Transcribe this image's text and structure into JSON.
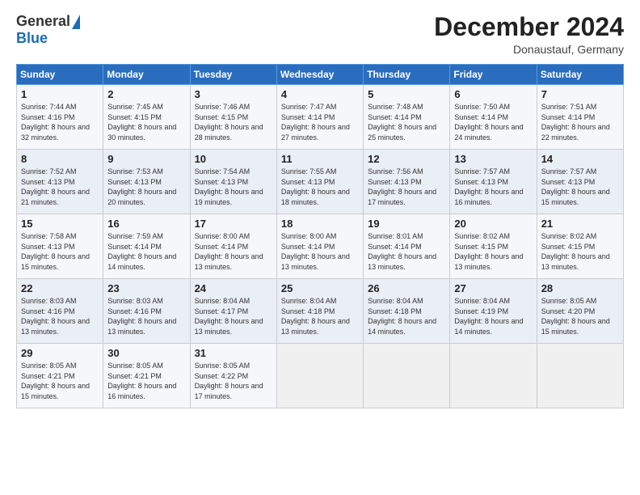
{
  "logo": {
    "general": "General",
    "blue": "Blue"
  },
  "header": {
    "month": "December 2024",
    "location": "Donaustauf, Germany"
  },
  "days_of_week": [
    "Sunday",
    "Monday",
    "Tuesday",
    "Wednesday",
    "Thursday",
    "Friday",
    "Saturday"
  ],
  "weeks": [
    [
      {
        "day": "1",
        "sunrise": "7:44 AM",
        "sunset": "4:16 PM",
        "daylight": "8 hours and 32 minutes."
      },
      {
        "day": "2",
        "sunrise": "7:45 AM",
        "sunset": "4:15 PM",
        "daylight": "8 hours and 30 minutes."
      },
      {
        "day": "3",
        "sunrise": "7:46 AM",
        "sunset": "4:15 PM",
        "daylight": "8 hours and 28 minutes."
      },
      {
        "day": "4",
        "sunrise": "7:47 AM",
        "sunset": "4:14 PM",
        "daylight": "8 hours and 27 minutes."
      },
      {
        "day": "5",
        "sunrise": "7:48 AM",
        "sunset": "4:14 PM",
        "daylight": "8 hours and 25 minutes."
      },
      {
        "day": "6",
        "sunrise": "7:50 AM",
        "sunset": "4:14 PM",
        "daylight": "8 hours and 24 minutes."
      },
      {
        "day": "7",
        "sunrise": "7:51 AM",
        "sunset": "4:14 PM",
        "daylight": "8 hours and 22 minutes."
      }
    ],
    [
      {
        "day": "8",
        "sunrise": "7:52 AM",
        "sunset": "4:13 PM",
        "daylight": "8 hours and 21 minutes."
      },
      {
        "day": "9",
        "sunrise": "7:53 AM",
        "sunset": "4:13 PM",
        "daylight": "8 hours and 20 minutes."
      },
      {
        "day": "10",
        "sunrise": "7:54 AM",
        "sunset": "4:13 PM",
        "daylight": "8 hours and 19 minutes."
      },
      {
        "day": "11",
        "sunrise": "7:55 AM",
        "sunset": "4:13 PM",
        "daylight": "8 hours and 18 minutes."
      },
      {
        "day": "12",
        "sunrise": "7:56 AM",
        "sunset": "4:13 PM",
        "daylight": "8 hours and 17 minutes."
      },
      {
        "day": "13",
        "sunrise": "7:57 AM",
        "sunset": "4:13 PM",
        "daylight": "8 hours and 16 minutes."
      },
      {
        "day": "14",
        "sunrise": "7:57 AM",
        "sunset": "4:13 PM",
        "daylight": "8 hours and 15 minutes."
      }
    ],
    [
      {
        "day": "15",
        "sunrise": "7:58 AM",
        "sunset": "4:13 PM",
        "daylight": "8 hours and 15 minutes."
      },
      {
        "day": "16",
        "sunrise": "7:59 AM",
        "sunset": "4:14 PM",
        "daylight": "8 hours and 14 minutes."
      },
      {
        "day": "17",
        "sunrise": "8:00 AM",
        "sunset": "4:14 PM",
        "daylight": "8 hours and 13 minutes."
      },
      {
        "day": "18",
        "sunrise": "8:00 AM",
        "sunset": "4:14 PM",
        "daylight": "8 hours and 13 minutes."
      },
      {
        "day": "19",
        "sunrise": "8:01 AM",
        "sunset": "4:14 PM",
        "daylight": "8 hours and 13 minutes."
      },
      {
        "day": "20",
        "sunrise": "8:02 AM",
        "sunset": "4:15 PM",
        "daylight": "8 hours and 13 minutes."
      },
      {
        "day": "21",
        "sunrise": "8:02 AM",
        "sunset": "4:15 PM",
        "daylight": "8 hours and 13 minutes."
      }
    ],
    [
      {
        "day": "22",
        "sunrise": "8:03 AM",
        "sunset": "4:16 PM",
        "daylight": "8 hours and 13 minutes."
      },
      {
        "day": "23",
        "sunrise": "8:03 AM",
        "sunset": "4:16 PM",
        "daylight": "8 hours and 13 minutes."
      },
      {
        "day": "24",
        "sunrise": "8:04 AM",
        "sunset": "4:17 PM",
        "daylight": "8 hours and 13 minutes."
      },
      {
        "day": "25",
        "sunrise": "8:04 AM",
        "sunset": "4:18 PM",
        "daylight": "8 hours and 13 minutes."
      },
      {
        "day": "26",
        "sunrise": "8:04 AM",
        "sunset": "4:18 PM",
        "daylight": "8 hours and 14 minutes."
      },
      {
        "day": "27",
        "sunrise": "8:04 AM",
        "sunset": "4:19 PM",
        "daylight": "8 hours and 14 minutes."
      },
      {
        "day": "28",
        "sunrise": "8:05 AM",
        "sunset": "4:20 PM",
        "daylight": "8 hours and 15 minutes."
      }
    ],
    [
      {
        "day": "29",
        "sunrise": "8:05 AM",
        "sunset": "4:21 PM",
        "daylight": "8 hours and 15 minutes."
      },
      {
        "day": "30",
        "sunrise": "8:05 AM",
        "sunset": "4:21 PM",
        "daylight": "8 hours and 16 minutes."
      },
      {
        "day": "31",
        "sunrise": "8:05 AM",
        "sunset": "4:22 PM",
        "daylight": "8 hours and 17 minutes."
      },
      null,
      null,
      null,
      null
    ]
  ]
}
